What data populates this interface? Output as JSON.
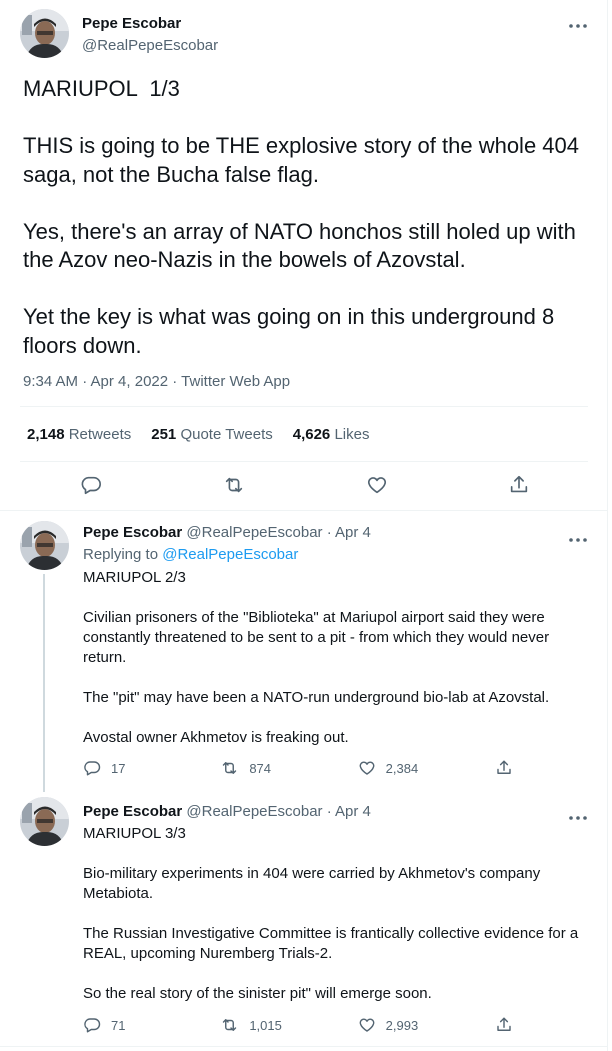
{
  "main_tweet": {
    "author_name": "Pepe Escobar",
    "author_handle": "@RealPepeEscobar",
    "more_icon": "more-icon",
    "text": "MARIUPOL  1/3\n\nTHIS is going to be THE explosive story of the whole 404 saga, not the Bucha false flag.\n\nYes, there's an array of NATO honchos still holed up with the Azov neo-Nazis in the bowels of Azovstal.\n\nYet the key is what was going on in this underground 8 floors down.",
    "meta": "9:34 AM · Apr 4, 2022 · Twitter Web App",
    "stats": {
      "retweets_count": "2,148",
      "retweets_label": "Retweets",
      "quotes_count": "251",
      "quotes_label": "Quote Tweets",
      "likes_count": "4,626",
      "likes_label": "Likes"
    },
    "actions": [
      "reply-icon",
      "retweet-icon",
      "like-icon",
      "share-icon"
    ]
  },
  "replies": [
    {
      "author_name": "Pepe Escobar",
      "author_handle": "@RealPepeEscobar",
      "date": "· Apr 4",
      "replying_prefix": "Replying to",
      "replying_to": "@RealPepeEscobar",
      "text": "MARIUPOL 2/3\n\nCivilian prisoners of the \"Biblioteka\" at Mariupol airport said they were constantly threatened to be sent to a pit - from which they would never return.\n\nThe \"pit\" may have been a NATO-run underground bio-lab at Azovstal.\n\nAvostal owner Akhmetov is freaking out.",
      "reply_count": "17",
      "retweet_count": "874",
      "like_count": "2,384"
    },
    {
      "author_name": "Pepe Escobar",
      "author_handle": "@RealPepeEscobar",
      "date": "· Apr 4",
      "text": "MARIUPOL 3/3\n\nBio-military experiments in 404 were carried by Akhmetov's company Metabiota.\n\nThe Russian Investigative Committee is frantically collective evidence for a REAL, upcoming Nuremberg Trials-2.\n\nSo the real story of the sinister pit\" will emerge soon.",
      "reply_count": "71",
      "retweet_count": "1,015",
      "like_count": "2,993"
    }
  ],
  "colors": {
    "text": "#0f1419",
    "secondary": "#536471",
    "link": "#1d9bf0",
    "divider": "#eff3f4",
    "thread_line": "#cfd9de"
  }
}
